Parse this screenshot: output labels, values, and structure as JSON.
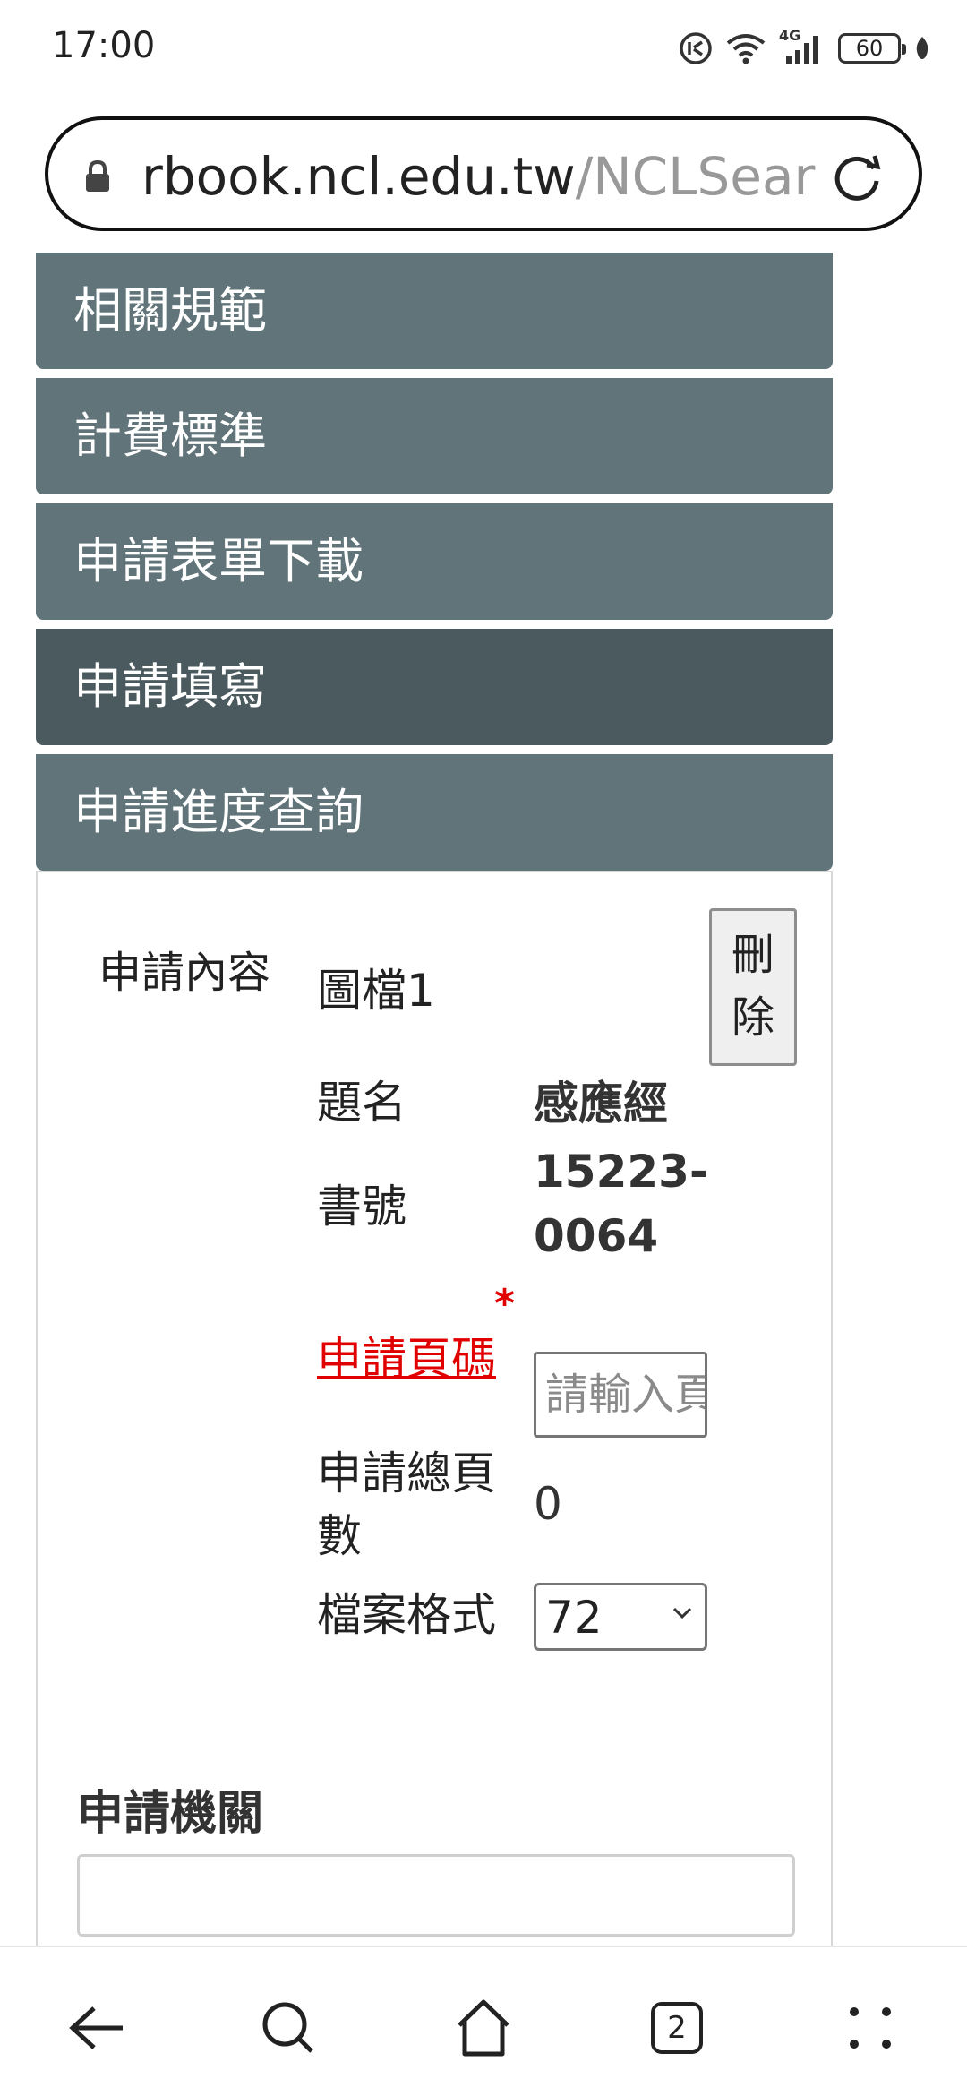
{
  "status_bar": {
    "time": "17:00",
    "network": "4G",
    "battery": "60"
  },
  "url_bar": {
    "domain": "rbook.ncl.edu.tw",
    "path": "/NCLSear"
  },
  "menu": {
    "items": [
      {
        "label": "相關規範"
      },
      {
        "label": "計費標準"
      },
      {
        "label": "申請表單下載"
      },
      {
        "label": "申請填寫"
      },
      {
        "label": "申請進度查詢"
      }
    ],
    "active_index": 3
  },
  "form": {
    "section_label": "申請內容",
    "file_name": "圖檔1",
    "delete_label": "刪除",
    "title_label": "題名",
    "title_value": "感應經",
    "call_number_label": "書號",
    "call_number_value": "15223-0064",
    "page_label": "申請頁碼",
    "required_mark": "*",
    "page_input_placeholder": "請輸入頁碼",
    "page_input_value": "",
    "total_pages_label": "申請總頁數",
    "total_pages_value": "0",
    "format_label": "檔案格式",
    "format_selected": "72",
    "org_label": "申請機關",
    "org_value": ""
  },
  "bottom_nav": {
    "tab_count": "2"
  },
  "colors": {
    "menu_bg": "#607479",
    "menu_active_bg": "#4b5a5e",
    "required_red": "#e10000"
  }
}
